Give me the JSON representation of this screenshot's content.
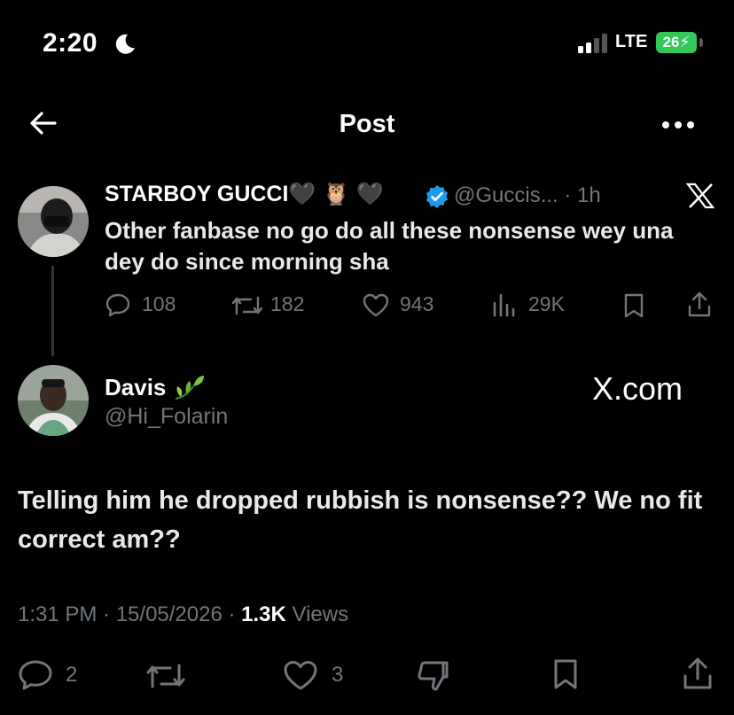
{
  "status_bar": {
    "time": "2:20",
    "network": "LTE",
    "battery": "26"
  },
  "header": {
    "title": "Post"
  },
  "quoted_post": {
    "display_name": "STARBOY GUCCI🖤 🦉 🖤",
    "handle_time": "@Guccis... · 1h",
    "text": "Other fanbase no go do all these nonsense wey una dey do since morning sha",
    "replies": "108",
    "reposts": "182",
    "likes": "943",
    "views": "29K"
  },
  "reply_post": {
    "display_name": "Davis",
    "handle": "@Hi_Folarin",
    "watermark": "X.com",
    "text": "Telling him he dropped rubbish is nonsense?? We no fit correct am??",
    "time_date": "1:31 PM · 15/05/2026 · ",
    "views_count": "1.3K",
    "views_label": " Views",
    "replies": "2",
    "likes": "3"
  },
  "colors": {
    "background": "#000000",
    "text": "#e7e9ea",
    "secondary": "#71767b",
    "verified": "#1d9bf0",
    "battery": "#34c759"
  }
}
